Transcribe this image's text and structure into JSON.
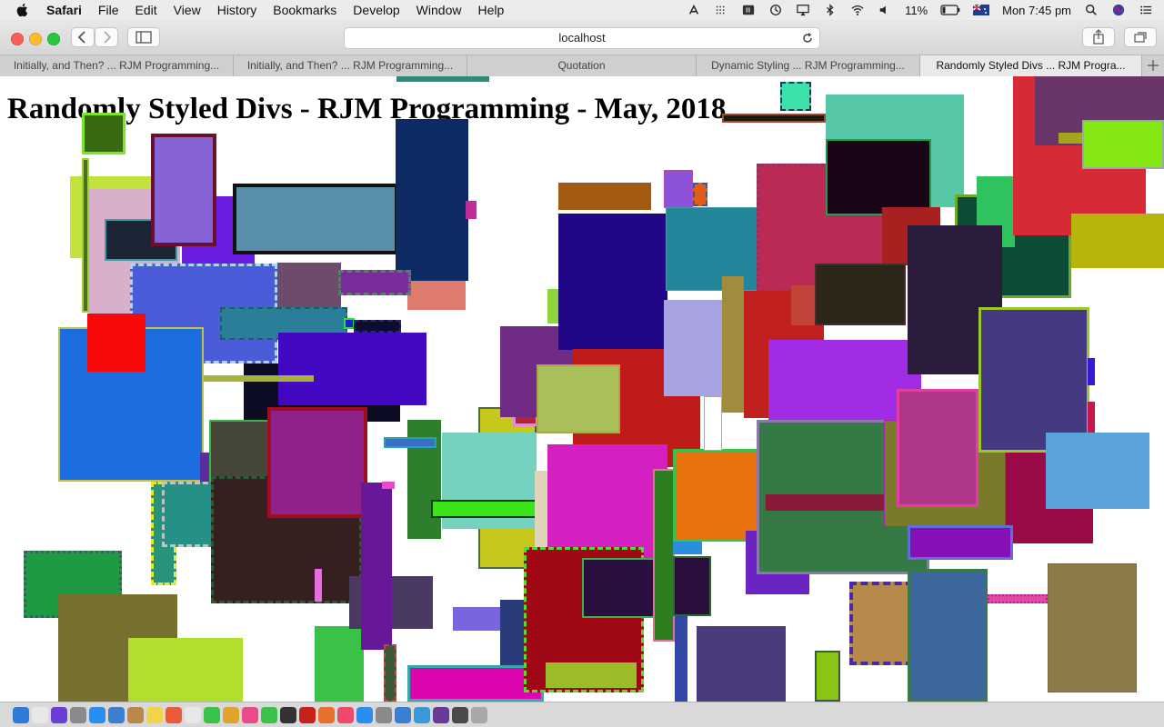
{
  "menubar": {
    "app": "Safari",
    "items": [
      "File",
      "Edit",
      "View",
      "History",
      "Bookmarks",
      "Develop",
      "Window",
      "Help"
    ],
    "battery": "11%",
    "clock": "Mon 7:45 pm"
  },
  "toolbar": {
    "url": "localhost"
  },
  "tabs": [
    {
      "label": "Initially, and Then? ... RJM Programming..."
    },
    {
      "label": "Initially, and Then? ... RJM Programming..."
    },
    {
      "label": "Quotation"
    },
    {
      "label": "Dynamic Styling ... RJM Programming..."
    },
    {
      "label": "Randomly Styled Divs ... RJM Progra..."
    }
  ],
  "page": {
    "heading": "Randomly Styled Divs - RJM Programming - May, 2018"
  },
  "colors": {
    "window_chrome": "#d6d6d6",
    "close": "#fc5f57",
    "minimize": "#fdbc2e",
    "zoom": "#28c840"
  },
  "dock": {
    "icons": [
      "finder",
      "document",
      "siri",
      "launchpad",
      "safari",
      "mail",
      "contacts",
      "notes",
      "calendar",
      "reminders",
      "messages",
      "chrome",
      "photos",
      "facetime",
      "terminal",
      "filezilla",
      "firefox",
      "music",
      "app-store",
      "system-preferences",
      "xcode",
      "preview",
      "github-desktop",
      "activity-monitor",
      "trash"
    ]
  }
}
